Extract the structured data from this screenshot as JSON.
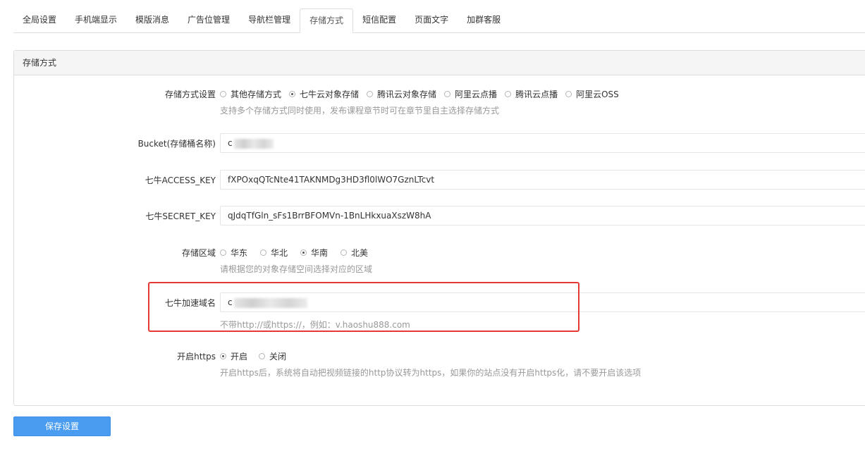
{
  "tabs": [
    "全局设置",
    "手机端显示",
    "模版消息",
    "广告位管理",
    "导航栏管理",
    "存储方式",
    "短信配置",
    "页面文字",
    "加群客服"
  ],
  "active_tab": 5,
  "panel": {
    "title": "存储方式"
  },
  "storage": {
    "label": "存储方式设置",
    "options": [
      "其他存储方式",
      "七牛云对象存储",
      "腾讯云对象存储",
      "阿里云点播",
      "腾讯云点播",
      "阿里云OSS"
    ],
    "selected": 1,
    "help": "支持多个存储方式同时使用，发布课程章节时可在章节里自主选择存储方式"
  },
  "bucket": {
    "label": "Bucket(存储桶名称)",
    "value": "c"
  },
  "access_key": {
    "label": "七牛ACCESS_KEY",
    "value": "fXPOxqQTcNte41TAKNMDg3HD3fl0lWO7GznLTcvt"
  },
  "secret_key": {
    "label": "七牛SECRET_KEY",
    "value": "qJdqTfGln_sFs1BrrBFOMVn-1BnLHkxuaXszW8hA"
  },
  "region": {
    "label": "存储区域",
    "options": [
      "华东",
      "华北",
      "华南",
      "北美"
    ],
    "selected": 2,
    "help": "请根据您的对象存储空间选择对应的区域"
  },
  "domain": {
    "label": "七牛加速域名",
    "value": "c",
    "help": "不带http://或https://，例如：v.haoshu888.com"
  },
  "https": {
    "label": "开启https",
    "options": [
      "开启",
      "关闭"
    ],
    "selected": 0,
    "help": "开启https后，系统将自动把视频链接的http协议转为https，如果你的站点没有开启https化，请不要开启该选项"
  },
  "save_label": "保存设置",
  "colors": {
    "primary": "#4a9cf0",
    "highlight": "#e53935"
  }
}
